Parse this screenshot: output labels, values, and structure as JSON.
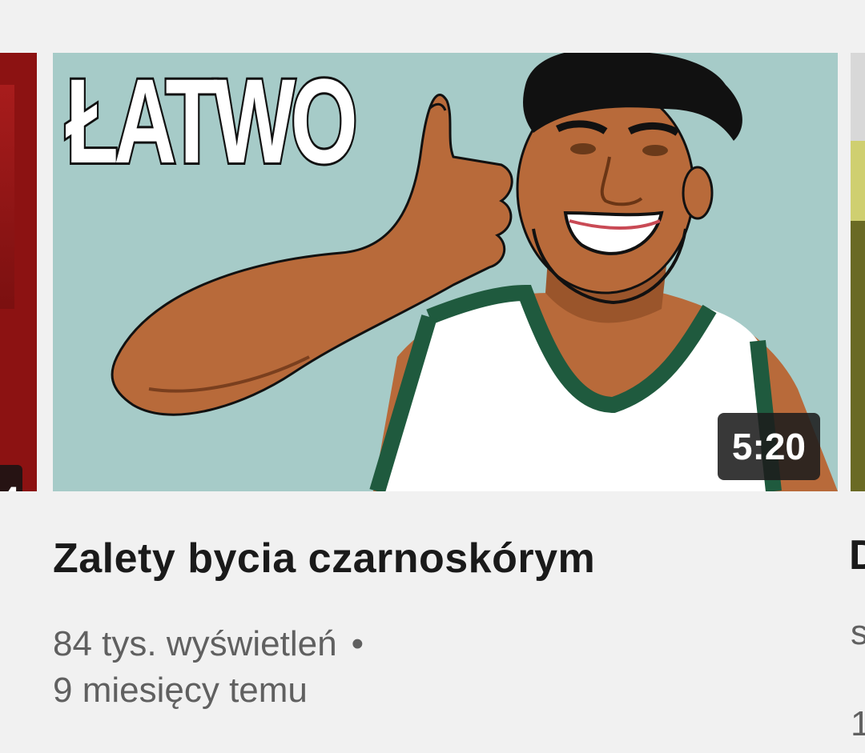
{
  "left_card": {
    "duration_partial": "4"
  },
  "video": {
    "thumbnail_text": "ŁATWO",
    "duration": "5:20",
    "title": "Zalety bycia czarnoskórym",
    "views": "84 tys. wyświetleń",
    "separator": "•",
    "published": "9 miesięcy temu"
  },
  "right_card": {
    "title_partial": "D",
    "subtitle_partial": "s",
    "meta_partial": "1"
  },
  "colors": {
    "thumbnail_bg": "#a6cbc8",
    "jersey_trim": "#1f5a3e",
    "skin": "#b86a3a",
    "page_bg": "#f1f1f1"
  }
}
